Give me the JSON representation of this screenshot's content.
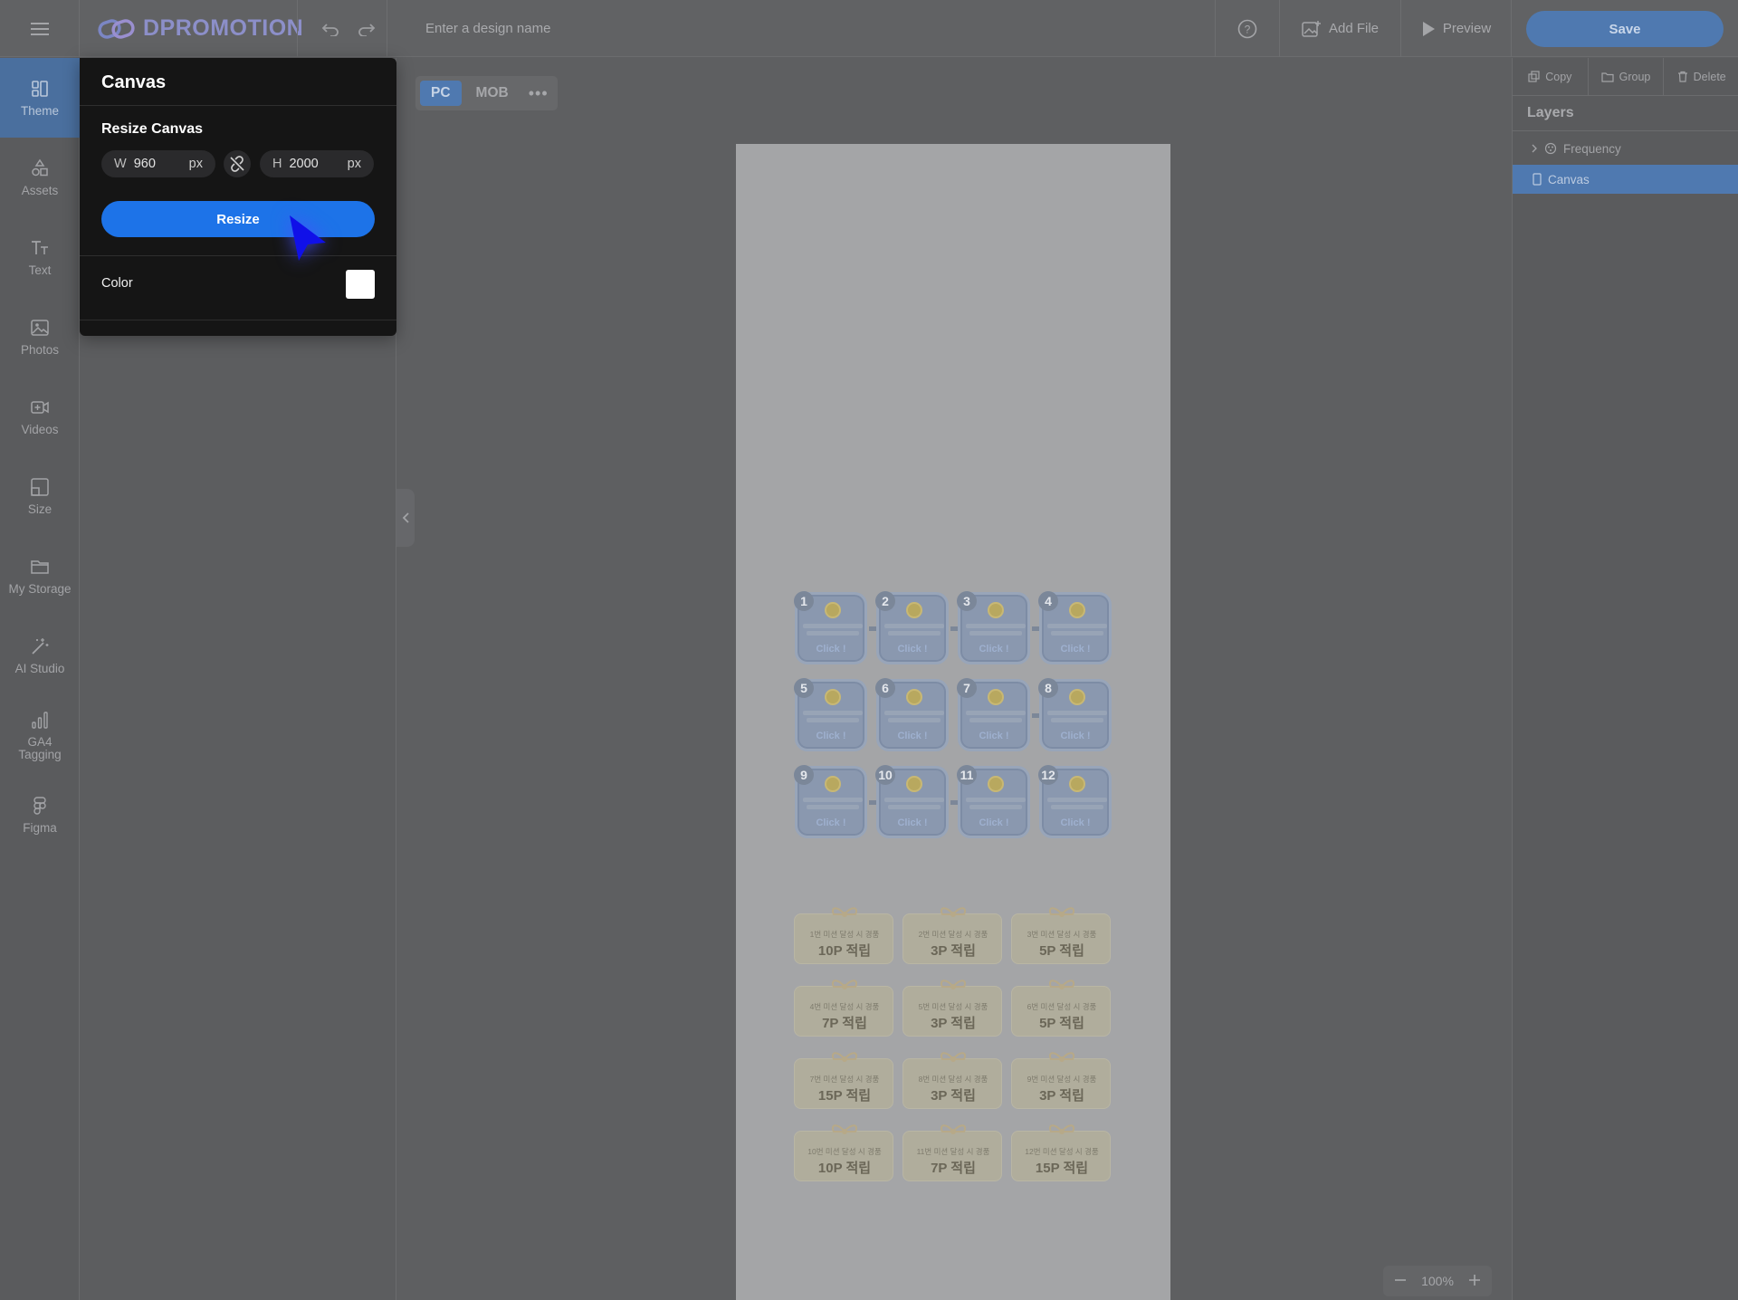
{
  "topbar": {
    "logo_text": "DPROMOTION",
    "design_name_placeholder": "Enter a design name",
    "add_file": "Add File",
    "preview": "Preview",
    "save": "Save"
  },
  "leftnav": {
    "items": [
      {
        "label": "Theme",
        "icon": "theme-icon"
      },
      {
        "label": "Assets",
        "icon": "shapes-icon"
      },
      {
        "label": "Text",
        "icon": "text-icon"
      },
      {
        "label": "Photos",
        "icon": "image-icon"
      },
      {
        "label": "Videos",
        "icon": "video-icon"
      },
      {
        "label": "Size",
        "icon": "size-icon"
      },
      {
        "label": "My Storage",
        "icon": "folder-icon"
      },
      {
        "label": "AI Studio",
        "icon": "magic-wand-icon"
      },
      {
        "label": "GA4 Tagging",
        "icon": "bar-chart-icon"
      },
      {
        "label": "Figma",
        "icon": "figma-icon"
      }
    ]
  },
  "canvas_popup": {
    "title": "Canvas",
    "subtitle": "Resize Canvas",
    "width_label": "W",
    "width_value": "960",
    "height_label": "H",
    "height_value": "2000",
    "unit": "px",
    "resize_button": "Resize",
    "color_label": "Color",
    "color_value": "#FFFFFF"
  },
  "device_toggle": {
    "pc": "PC",
    "mob": "MOB"
  },
  "artboard": {
    "mission_cards": [
      {
        "num": "1",
        "click": "Click !"
      },
      {
        "num": "2",
        "click": "Click !"
      },
      {
        "num": "3",
        "click": "Click !"
      },
      {
        "num": "4",
        "click": "Click !"
      },
      {
        "num": "5",
        "click": "Click !"
      },
      {
        "num": "6",
        "click": "Click !"
      },
      {
        "num": "7",
        "click": "Click !"
      },
      {
        "num": "8",
        "click": "Click !"
      },
      {
        "num": "9",
        "click": "Click !"
      },
      {
        "num": "10",
        "click": "Click !"
      },
      {
        "num": "11",
        "click": "Click !"
      },
      {
        "num": "12",
        "click": "Click !"
      }
    ],
    "reward_cards": [
      {
        "small": "1번 미션 달성 시 경품",
        "big": "10P 적립"
      },
      {
        "small": "2번 미션 달성 시 경품",
        "big": "3P 적립"
      },
      {
        "small": "3번 미션 달성 시 경품",
        "big": "5P 적립"
      },
      {
        "small": "4번 미션 달성 시 경품",
        "big": "7P 적립"
      },
      {
        "small": "5번 미션 달성 시 경품",
        "big": "3P 적립"
      },
      {
        "small": "6번 미션 달성 시 경품",
        "big": "5P 적립"
      },
      {
        "small": "7번 미션 달성 시 경품",
        "big": "15P 적립"
      },
      {
        "small": "8번 미션 달성 시 경품",
        "big": "3P 적립"
      },
      {
        "small": "9번 미션 달성 시 경품",
        "big": "3P 적립"
      },
      {
        "small": "10번 미션 달성 시 경품",
        "big": "10P 적립"
      },
      {
        "small": "11번 미션 달성 시 경품",
        "big": "7P 적립"
      },
      {
        "small": "12번 미션 달성 시 경품",
        "big": "15P 적립"
      }
    ]
  },
  "zoom": {
    "level": "100%"
  },
  "rightpanel": {
    "copy": "Copy",
    "group": "Group",
    "delete": "Delete",
    "layers_title": "Layers",
    "layers": [
      {
        "name": "Frequency"
      },
      {
        "name": "Canvas"
      }
    ]
  },
  "colors": {
    "accent": "#1D73E8",
    "save_dim": "#4F79B0",
    "popup_bg": "#151515"
  }
}
